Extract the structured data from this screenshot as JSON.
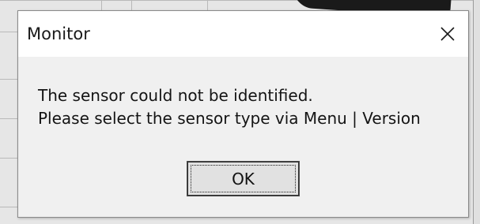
{
  "dialog": {
    "title": "Monitor",
    "close_icon": "close-icon",
    "message_lines": [
      "The sensor could not be identified.",
      "Please select the sensor type via Menu | Version"
    ],
    "ok_label": "OK"
  },
  "colors": {
    "titlebar_bg": "#ffffff",
    "content_bg": "#f0f0f0",
    "button_bg": "#e1e1e1",
    "text": "#141414"
  }
}
